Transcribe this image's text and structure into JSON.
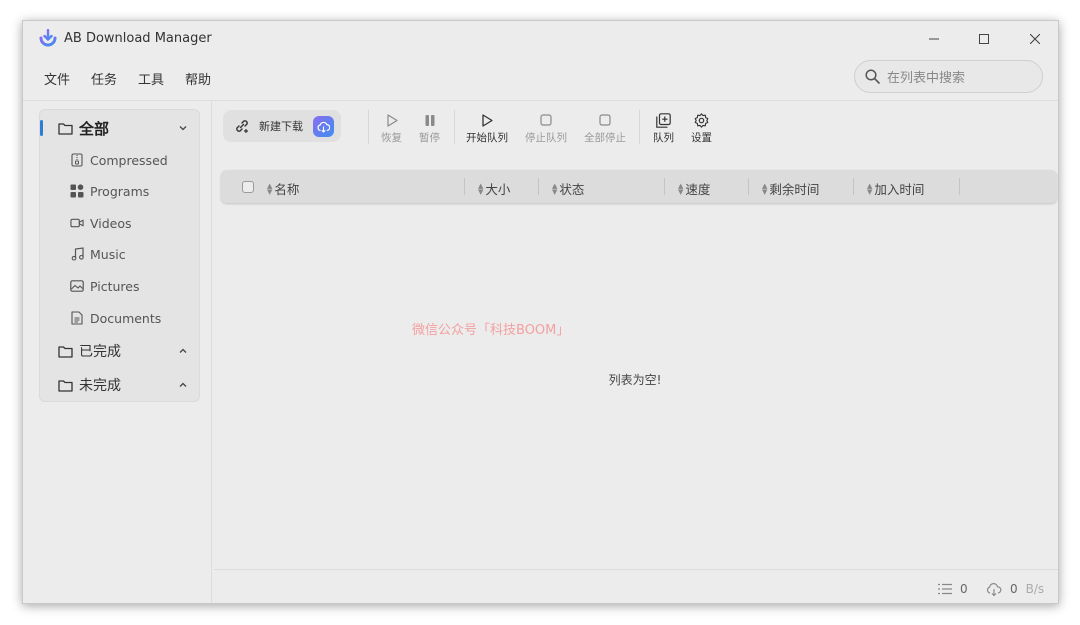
{
  "app": {
    "title": "AB Download Manager"
  },
  "menu": [
    "文件",
    "任务",
    "工具",
    "帮助"
  ],
  "search": {
    "placeholder": "在列表中搜索"
  },
  "sidebar": {
    "all": {
      "label": "全部",
      "selected": true,
      "expanded": true
    },
    "subcategories": [
      {
        "label": "Compressed",
        "icon": "zip-file-icon"
      },
      {
        "label": "Programs",
        "icon": "apps-icon"
      },
      {
        "label": "Videos",
        "icon": "video-icon"
      },
      {
        "label": "Music",
        "icon": "music-icon"
      },
      {
        "label": "Pictures",
        "icon": "image-icon"
      },
      {
        "label": "Documents",
        "icon": "document-icon"
      }
    ],
    "finished": {
      "label": "已完成"
    },
    "unfinished": {
      "label": "未完成"
    }
  },
  "toolbar": {
    "new_download": "新建下载",
    "resume": "恢复",
    "pause": "暂停",
    "start_queue": "开始队列",
    "stop_queue": "停止队列",
    "stop_all": "全部停止",
    "queues": "队列",
    "settings": "设置"
  },
  "table": {
    "columns": [
      "名称",
      "大小",
      "状态",
      "速度",
      "剩余时间",
      "加入时间"
    ],
    "empty_message": "列表为空!"
  },
  "watermark": "微信公众号「科技BOOM」",
  "status_bar": {
    "active_count": "0",
    "speed_value": "0",
    "speed_unit": "B/s"
  },
  "colors": {
    "accent": "#2a7fd4",
    "cloud_gradient_start": "#8a6df0",
    "cloud_gradient_end": "#3f8ef0"
  }
}
